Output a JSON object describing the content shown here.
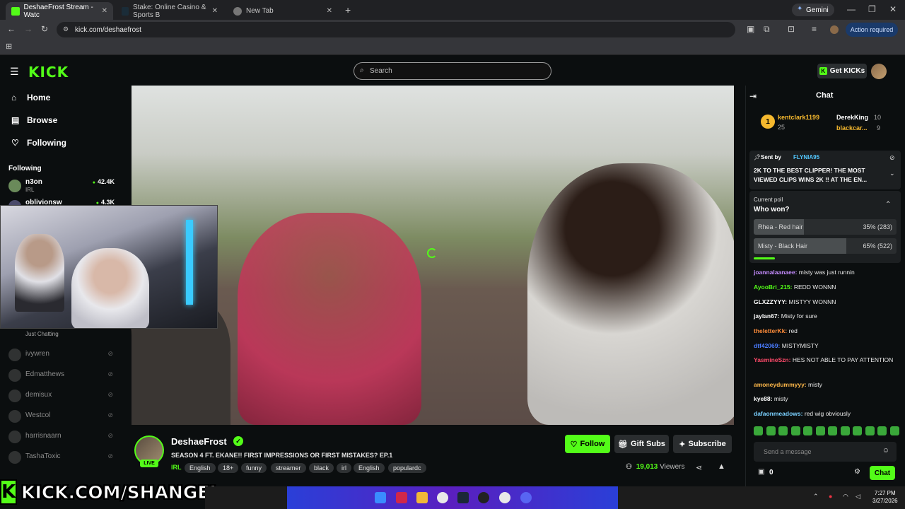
{
  "browser": {
    "tabs": [
      {
        "label": "DeshaeFrost Stream - Watc",
        "active": true
      },
      {
        "label": "Stake: Online Casino & Sports B",
        "active": false
      },
      {
        "label": "New Tab",
        "active": false
      }
    ],
    "url": "kick.com/deshaefrost",
    "gemini": "Gemini",
    "action_required": "Action required"
  },
  "header": {
    "logo": "KICK",
    "search_placeholder": "Search",
    "get_kicks": "Get KICKs"
  },
  "sidebar": {
    "nav": [
      {
        "label": "Home",
        "icon": "home-icon"
      },
      {
        "label": "Browse",
        "icon": "browse-icon"
      },
      {
        "label": "Following",
        "icon": "heart-icon"
      }
    ],
    "following_title": "Following",
    "channels_live": [
      {
        "name": "n3on",
        "sub": "IRL",
        "viewers": "42.4K"
      },
      {
        "name": "oblivionsw",
        "sub": "",
        "viewers": "4.3K"
      }
    ],
    "channels_partial": [
      {
        "name": "Just Chatting"
      }
    ],
    "channels_offline": [
      "ivywren",
      "Edmatthews",
      "demisux",
      "Westcol",
      "harrisnaarn",
      "TashaToxic"
    ]
  },
  "stream": {
    "channel": "DeshaeFrost",
    "live_badge": "LIVE",
    "title": "SEASON 4 FT. EKANE!! FIRST IMPRESSIONS OR FIRST MISTAKES? EP.1",
    "category": "IRL",
    "tags": [
      "English",
      "18+",
      "funny",
      "streamer",
      "black",
      "irl",
      "English",
      "populardc"
    ],
    "follow": "Follow",
    "gift_subs": "Gift Subs",
    "subscribe": "Subscribe",
    "viewers": "19,013",
    "viewers_label": "Viewers"
  },
  "chat": {
    "title": "Chat",
    "leaderboard": [
      {
        "rank": "1",
        "name": "kentclark1199",
        "count": "25"
      },
      {
        "name": "DerekKing",
        "count": "10"
      },
      {
        "name": "blackcar...",
        "count": "9"
      }
    ],
    "pinned": {
      "sent_by_label": "Sent by",
      "sender": "FLYNIA95",
      "text": "2K TO THE BEST CLIPPER! THE MOST VIEWED CLIPS WINS 2K !! AT THE EN..."
    },
    "poll": {
      "label": "Current poll",
      "question": "Who won?",
      "options": [
        {
          "label": "Rhea - Red hair",
          "result": "35% (283)",
          "pct": 35
        },
        {
          "label": "Misty - Black Hair",
          "result": "65% (522)",
          "pct": 65
        }
      ]
    },
    "messages": [
      {
        "user": "joannalaanaee:",
        "text": "misty was just runnin",
        "color": "#c58cff"
      },
      {
        "user": "AyooBri_215:",
        "text": "REDD WONNN",
        "color": "#53fc18"
      },
      {
        "user": "GLXZZYYY:",
        "text": "MISTYY WONNN",
        "color": "#ffffff"
      },
      {
        "user": "jaylan67:",
        "text": "Misty for sure",
        "color": "#ffffff"
      },
      {
        "user": "theletterKk:",
        "text": "red",
        "color": "#ff8c3a"
      },
      {
        "user": "dtf42069:",
        "text": "MISTYMISTY",
        "color": "#4a7cff"
      },
      {
        "user": "YasmineSzn:",
        "text": "HES NOT ABLE TO PAY ATTENTION",
        "color": "#ff4a6a"
      },
      {
        "user": "amoneydummyyy:",
        "text": "misty",
        "color": "#ffb84a"
      },
      {
        "user": "kye88:",
        "text": "misty",
        "color": "#ffffff"
      },
      {
        "user": "dafaonmeadows:",
        "text": "red wig obviously",
        "color": "#7ad0ff"
      }
    ],
    "input_placeholder": "Send a message",
    "points": "0",
    "send": "Chat"
  },
  "overlay": {
    "banner": "KICK.COM/SHANGEL"
  },
  "taskbar": {
    "time": "7:27 PM",
    "date": "3/27/2026"
  },
  "colors": {
    "accent": "#53fc18",
    "background": "#0b0e0f"
  }
}
